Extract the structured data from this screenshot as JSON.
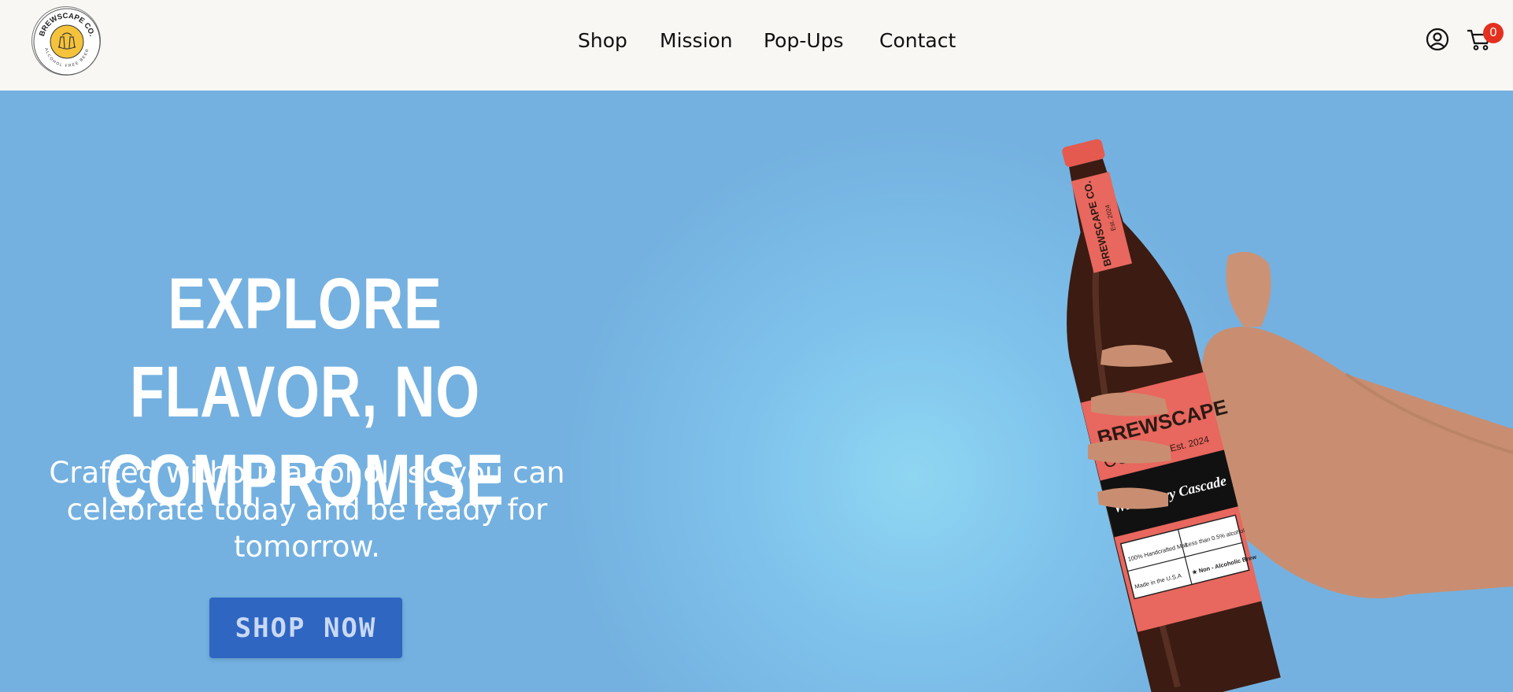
{
  "brand": {
    "logo_name": "BREWSCAPE CO.",
    "logo_tagline": "ALCOHOL FREE BEER"
  },
  "nav": {
    "items": [
      "Shop",
      "Mission",
      "Pop-Ups",
      "Contact"
    ]
  },
  "header": {
    "account_icon": "user-circle-icon",
    "cart_icon": "shopping-cart-icon",
    "cart_count": "0"
  },
  "hero": {
    "title_line1": "EXPLORE FLAVOR, NO",
    "title_line2": "COMPROMISE",
    "subtitle": "Crafted without alcohol, so you can celebrate today and be ready for tomorrow.",
    "cta_label": "SHOP NOW"
  },
  "product": {
    "neck_brand": "BREWSCAPE CO.",
    "neck_est": "Est. 2024",
    "label_brand_line1": "BREWSCAPE",
    "label_brand_line2": "CO.",
    "label_est": "Est. 2024",
    "flavor": "Wild Berry Cascade",
    "badge1": "100% Handcrafted Malt",
    "badge2": "Made in the U.S.A",
    "badge3": "Less than 0.5% alcohol",
    "badge4": "★ Non - Alcoholic Brew"
  },
  "colors": {
    "hero_bg": "#74b1e0",
    "header_bg": "#f9f7f3",
    "cta_bg": "#2f66c2",
    "badge_red": "#e4301f",
    "label_coral": "#e8675e",
    "logo_yellow": "#f5c33b"
  }
}
